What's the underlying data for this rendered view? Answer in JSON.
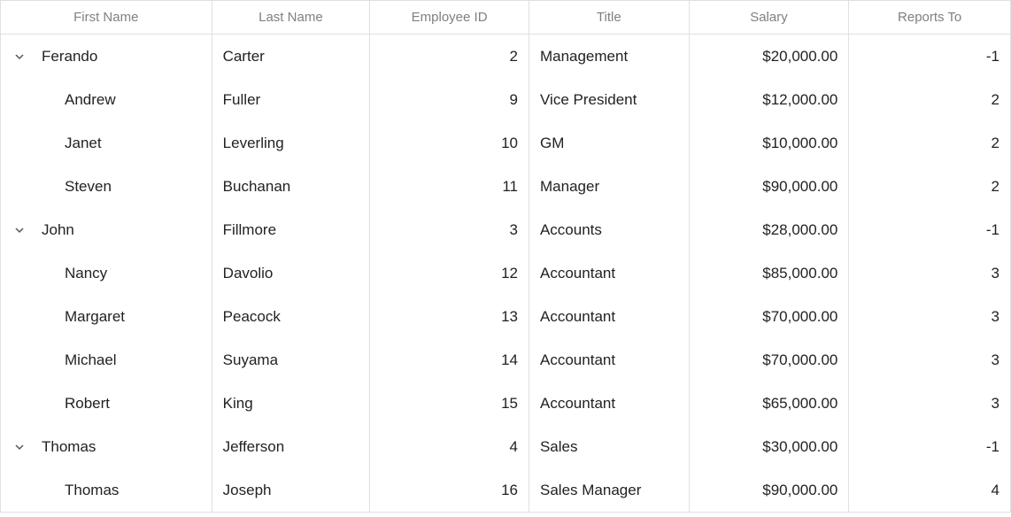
{
  "columns": {
    "first_name": "First Name",
    "last_name": "Last Name",
    "employee_id": "Employee ID",
    "title": "Title",
    "salary": "Salary",
    "reports_to": "Reports To"
  },
  "rows": [
    {
      "level": 0,
      "expanded": true,
      "first_name": "Ferando",
      "last_name": "Carter",
      "employee_id": "2",
      "title": "Management",
      "salary": "$20,000.00",
      "reports_to": "-1"
    },
    {
      "level": 1,
      "first_name": "Andrew",
      "last_name": "Fuller",
      "employee_id": "9",
      "title": "Vice President",
      "salary": "$12,000.00",
      "reports_to": "2"
    },
    {
      "level": 1,
      "first_name": "Janet",
      "last_name": "Leverling",
      "employee_id": "10",
      "title": "GM",
      "salary": "$10,000.00",
      "reports_to": "2"
    },
    {
      "level": 1,
      "first_name": "Steven",
      "last_name": "Buchanan",
      "employee_id": "11",
      "title": "Manager",
      "salary": "$90,000.00",
      "reports_to": "2"
    },
    {
      "level": 0,
      "expanded": true,
      "first_name": "John",
      "last_name": "Fillmore",
      "employee_id": "3",
      "title": "Accounts",
      "salary": "$28,000.00",
      "reports_to": "-1"
    },
    {
      "level": 1,
      "first_name": "Nancy",
      "last_name": "Davolio",
      "employee_id": "12",
      "title": "Accountant",
      "salary": "$85,000.00",
      "reports_to": "3"
    },
    {
      "level": 1,
      "first_name": "Margaret",
      "last_name": "Peacock",
      "employee_id": "13",
      "title": "Accountant",
      "salary": "$70,000.00",
      "reports_to": "3"
    },
    {
      "level": 1,
      "first_name": "Michael",
      "last_name": "Suyama",
      "employee_id": "14",
      "title": "Accountant",
      "salary": "$70,000.00",
      "reports_to": "3"
    },
    {
      "level": 1,
      "first_name": "Robert",
      "last_name": "King",
      "employee_id": "15",
      "title": "Accountant",
      "salary": "$65,000.00",
      "reports_to": "3"
    },
    {
      "level": 0,
      "expanded": true,
      "first_name": "Thomas",
      "last_name": "Jefferson",
      "employee_id": "4",
      "title": "Sales",
      "salary": "$30,000.00",
      "reports_to": "-1"
    },
    {
      "level": 1,
      "first_name": "Thomas",
      "last_name": "Joseph",
      "employee_id": "16",
      "title": "Sales Manager",
      "salary": "$90,000.00",
      "reports_to": "4"
    }
  ]
}
